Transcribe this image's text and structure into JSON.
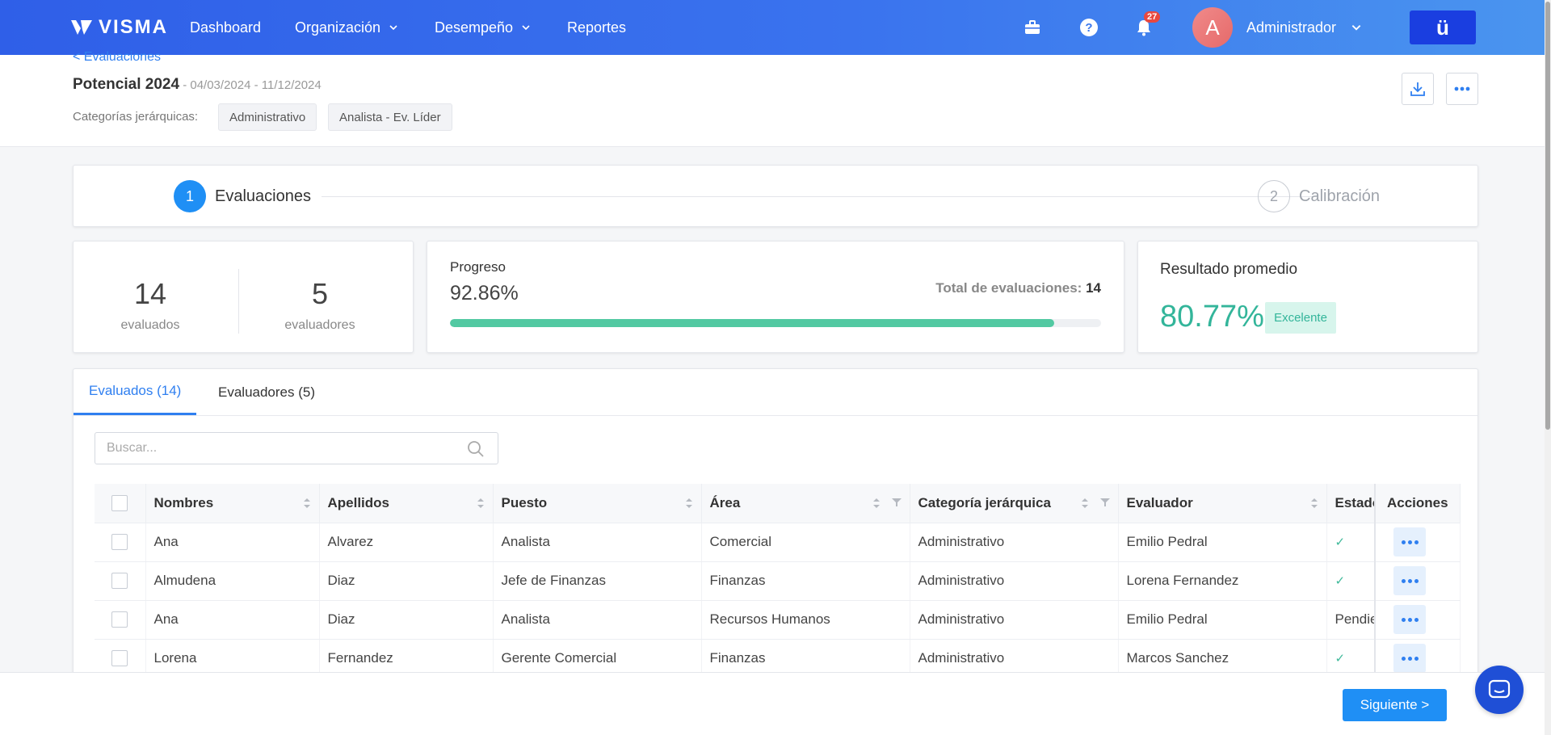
{
  "nav": {
    "logo": "VISMA",
    "items": [
      {
        "label": "Dashboard",
        "has_dropdown": false
      },
      {
        "label": "Organización",
        "has_dropdown": true
      },
      {
        "label": "Desempeño",
        "has_dropdown": true
      },
      {
        "label": "Reportes",
        "has_dropdown": false
      }
    ],
    "icons": [
      "briefcase-icon",
      "help-icon",
      "bell-icon"
    ],
    "notification_count": "27",
    "avatar_initial": "A",
    "user_name": "Administrador",
    "apps_button": "ü"
  },
  "header": {
    "back_link": "< Evaluaciones",
    "title": "Potencial 2024",
    "dates": " - 04/03/2024 - 11/12/2024",
    "categories_label": "Categorías jerárquicas:",
    "categories": [
      "Administrativo",
      "Analista - Ev. Líder"
    ]
  },
  "stepper": {
    "steps": [
      {
        "number": "1",
        "label": "Evaluaciones",
        "active": true
      },
      {
        "number": "2",
        "label": "Calibración",
        "active": false
      }
    ]
  },
  "stats": {
    "evaluados_count": "14",
    "evaluados_label": "evaluados",
    "evaluadores_count": "5",
    "evaluadores_label": "evaluadores"
  },
  "progress": {
    "title": "Progreso",
    "percent_text": "92.86%",
    "fraction": 0.9286,
    "total_label": "Total de evaluaciones:",
    "total_value": "14"
  },
  "result": {
    "title": "Resultado promedio",
    "value": "80.77%",
    "badge": "Excelente"
  },
  "tabs": [
    {
      "label": "Evaluados (14)",
      "active": true
    },
    {
      "label": "Evaluadores (5)",
      "active": false
    }
  ],
  "search": {
    "placeholder": "Buscar...",
    "value": ""
  },
  "table": {
    "columns": [
      "Nombres",
      "Apellidos",
      "Puesto",
      "Área",
      "Categoría jerárquica",
      "Evaluador",
      "Estado",
      "Acciones"
    ],
    "rows": [
      {
        "nombres": "Ana",
        "apellidos": "Alvarez",
        "puesto": "Analista",
        "area": "Comercial",
        "categoria": "Administrativo",
        "evaluador": "Emilio Pedral",
        "estado": "✓"
      },
      {
        "nombres": "Almudena",
        "apellidos": "Diaz",
        "puesto": "Jefe de Finanzas",
        "area": "Finanzas",
        "categoria": "Administrativo",
        "evaluador": "Lorena Fernandez",
        "estado": "✓"
      },
      {
        "nombres": "Ana",
        "apellidos": "Diaz",
        "puesto": "Analista",
        "area": "Recursos Humanos",
        "categoria": "Administrativo",
        "evaluador": "Emilio Pedral",
        "estado": "Pendie"
      },
      {
        "nombres": "Lorena",
        "apellidos": "Fernandez",
        "puesto": "Gerente Comercial",
        "area": "Finanzas",
        "categoria": "Administrativo",
        "evaluador": "Marcos Sanchez",
        "estado": "✓"
      }
    ]
  },
  "footer": {
    "next_button": "Siguiente >"
  },
  "colors": {
    "accent": "#2f7ff0",
    "success": "#52c9a2",
    "result": "#33b59a",
    "nav_start": "#2f5fe8"
  }
}
